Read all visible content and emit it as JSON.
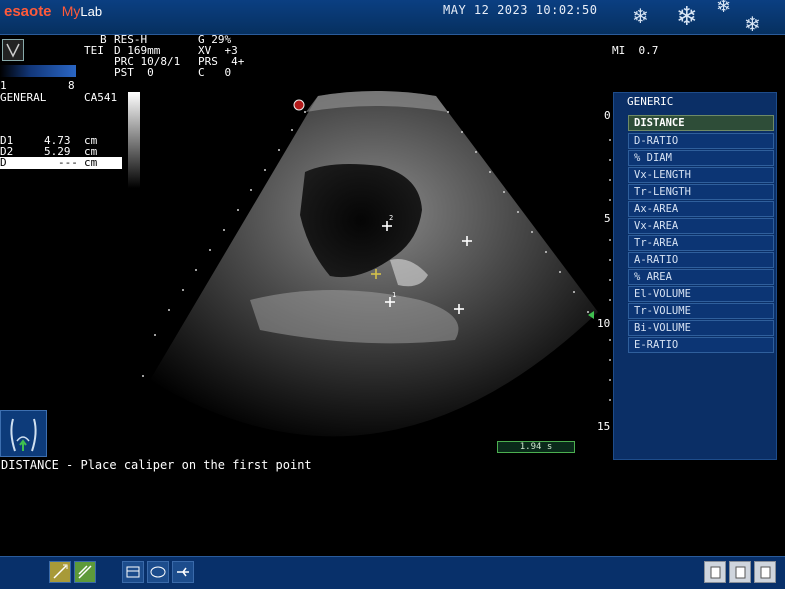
{
  "header": {
    "brand": "esaote",
    "product_a": "My",
    "product_b": "Lab",
    "datetime": "MAY 12 2023 10:02:50"
  },
  "params": {
    "col1": [
      "B",
      "TEI",
      "",
      ""
    ],
    "col2": [
      "RES-H",
      "D 169mm",
      "PRC 10/8/1",
      "PST  0"
    ],
    "col3": [
      "G 29%",
      "XV  +3",
      "PRS  4+",
      "C   0"
    ],
    "mi": "MI  0.7",
    "gain_scale_left": "1",
    "gain_scale_right": "8",
    "preset": "GENERAL",
    "probe": "CA541"
  },
  "measurements": [
    {
      "label": "D1",
      "value": "4.73",
      "unit": "cm"
    },
    {
      "label": "D2",
      "value": "5.29",
      "unit": "cm"
    },
    {
      "label": "D",
      "value": "---",
      "unit": "cm"
    }
  ],
  "depth_scale": [
    "0",
    "5",
    "10",
    "15"
  ],
  "menu": {
    "title": "GENERIC",
    "items": [
      "DISTANCE",
      "D-RATIO",
      "% DIAM",
      "Vx-LENGTH",
      "Tr-LENGTH",
      "Ax-AREA",
      "Vx-AREA",
      "Tr-AREA",
      "A-RATIO",
      "% AREA",
      "El-VOLUME",
      "Tr-VOLUME",
      "Bi-VOLUME",
      "E-RATIO"
    ],
    "selected": "DISTANCE"
  },
  "timebox": "1.94 s",
  "prompt": "DISTANCE - Place caliper on the first point",
  "calipers": [
    "1",
    "2"
  ],
  "icons": {
    "probe": "probe-icon",
    "body": "body-marker-icon",
    "snowflake": "snowflake-icon"
  },
  "colors": {
    "topbar": "#0b3f82",
    "menu_bg": "#0b2f66",
    "selected": "#2e4d38",
    "logo": "#ff5a3a",
    "caliper_active": "#d4c24a"
  }
}
